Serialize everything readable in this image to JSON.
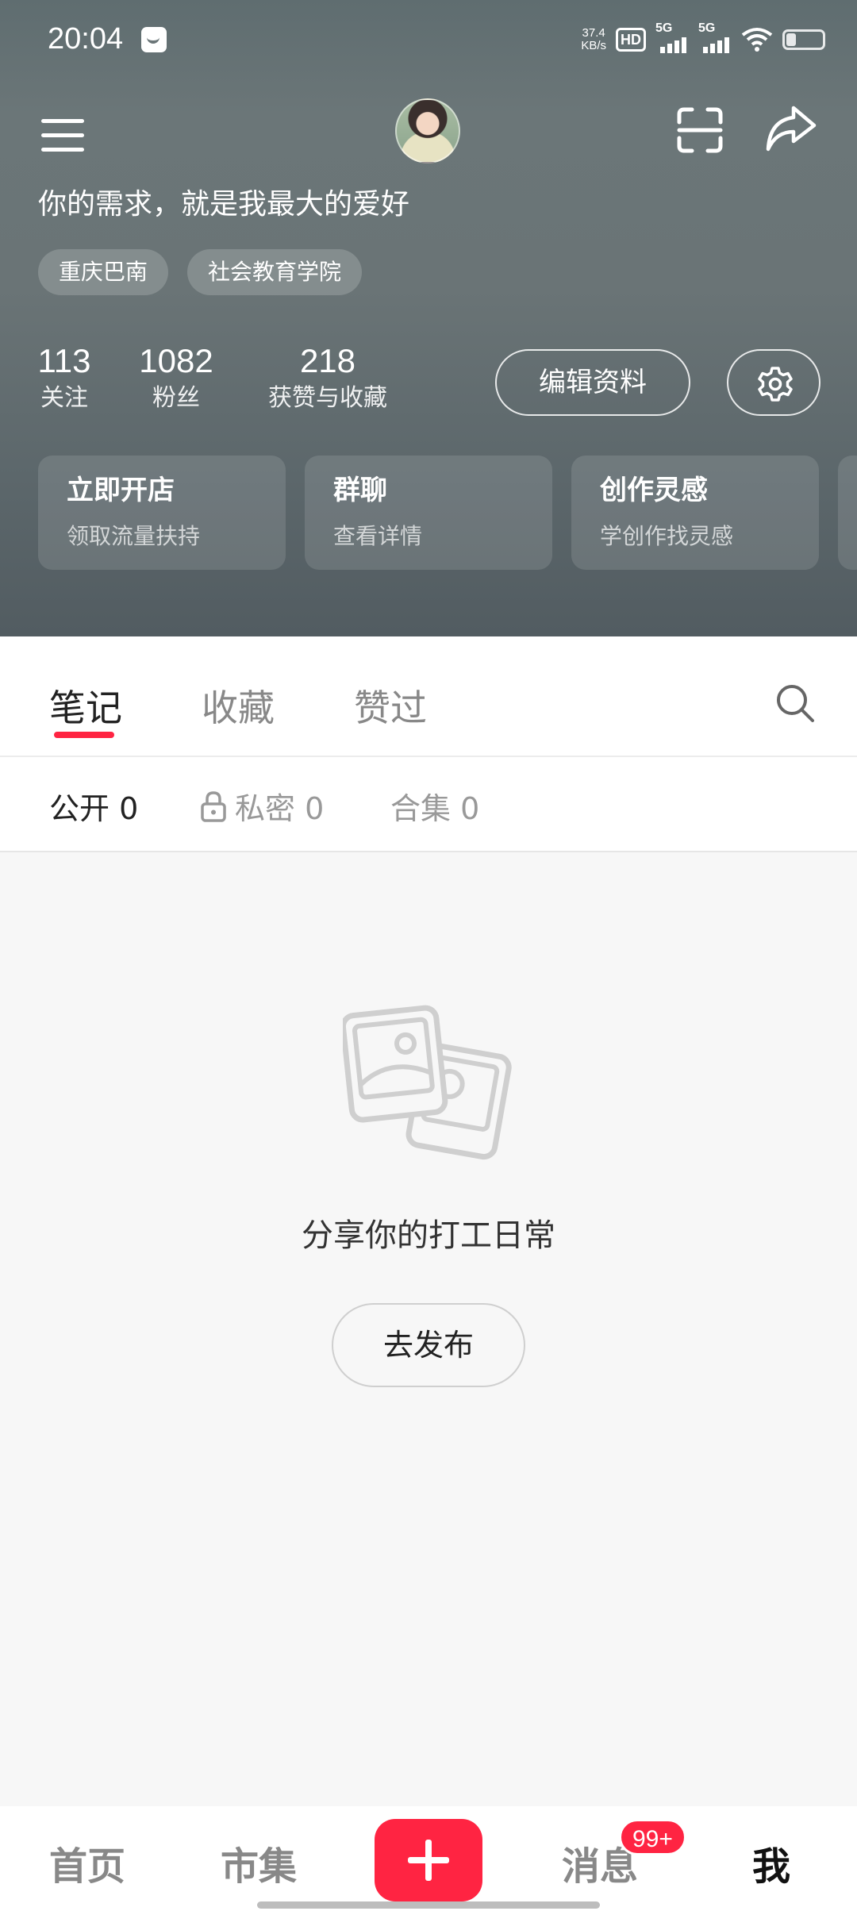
{
  "status_bar": {
    "time": "20:04",
    "net_speed_value": "37.4",
    "net_speed_unit": "KB/s",
    "hd_label": "HD",
    "signal1_label": "5G",
    "signal2_label": "5G"
  },
  "profile": {
    "bio": "你的需求，就是我最大的爱好",
    "tags": [
      "重庆巴南",
      "社会教育学院"
    ],
    "stats": [
      {
        "value": "113",
        "label": "关注"
      },
      {
        "value": "1082",
        "label": "粉丝"
      },
      {
        "value": "218",
        "label": "获赞与收藏"
      }
    ],
    "edit_label": "编辑资料"
  },
  "cards": [
    {
      "title": "立即开店",
      "subtitle": "领取流量扶持"
    },
    {
      "title": "群聊",
      "subtitle": "查看详情"
    },
    {
      "title": "创作灵感",
      "subtitle": "学创作找灵感"
    }
  ],
  "tabs": [
    "笔记",
    "收藏",
    "赞过"
  ],
  "subtabs": [
    {
      "label": "公开 0"
    },
    {
      "label": "私密 0"
    },
    {
      "label": "合集 0"
    }
  ],
  "empty": {
    "text": "分享你的打工日常",
    "button": "去发布"
  },
  "bottom_nav": {
    "items": [
      "首页",
      "市集",
      "消息",
      "我"
    ],
    "message_badge": "99+"
  },
  "colors": {
    "accent": "#ff2442",
    "header_bg": "#6a7476"
  }
}
